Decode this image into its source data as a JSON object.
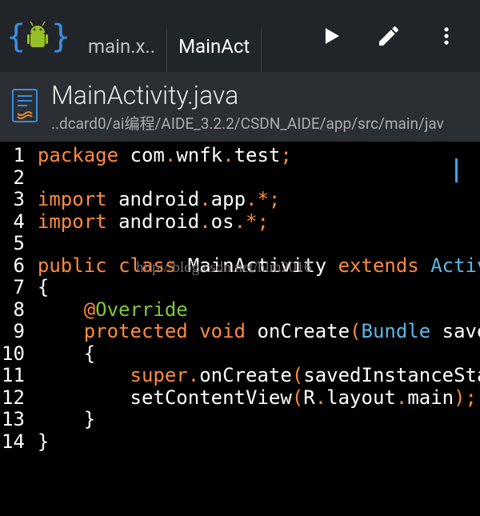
{
  "topbar": {
    "tabs": [
      {
        "label": "main.x.."
      },
      {
        "label": "MainAct"
      }
    ]
  },
  "fileHeader": {
    "title": "MainActivity.java",
    "path": "..dcard0/ai编程/AIDE_3.2.2/CSDN_AIDE/app/src/main/jav"
  },
  "code": {
    "lines": [
      {
        "n": "1",
        "tokens": [
          [
            "kw",
            "package "
          ],
          [
            "id",
            "com"
          ],
          [
            "op",
            "."
          ],
          [
            "id",
            "wnfk"
          ],
          [
            "op",
            "."
          ],
          [
            "id",
            "test"
          ],
          [
            "op",
            ";"
          ]
        ]
      },
      {
        "n": "2",
        "tokens": []
      },
      {
        "n": "3",
        "tokens": [
          [
            "kw",
            "import "
          ],
          [
            "id",
            "android"
          ],
          [
            "op",
            "."
          ],
          [
            "id",
            "app"
          ],
          [
            "op",
            ".*;"
          ]
        ]
      },
      {
        "n": "4",
        "tokens": [
          [
            "kw",
            "import "
          ],
          [
            "id",
            "android"
          ],
          [
            "op",
            "."
          ],
          [
            "id",
            "os"
          ],
          [
            "op",
            ".*;"
          ]
        ]
      },
      {
        "n": "5",
        "tokens": []
      },
      {
        "n": "6",
        "tokens": [
          [
            "kw",
            "public "
          ],
          [
            "kw",
            "class "
          ],
          [
            "id",
            "MainActivity "
          ],
          [
            "kw",
            "extends "
          ],
          [
            "ty",
            "Activity"
          ]
        ]
      },
      {
        "n": "7",
        "tokens": [
          [
            "id",
            "{"
          ]
        ]
      },
      {
        "n": "8",
        "tokens": [
          [
            "id",
            "    "
          ],
          [
            "op",
            "@"
          ],
          [
            "an",
            "Override"
          ]
        ]
      },
      {
        "n": "9",
        "tokens": [
          [
            "id",
            "    "
          ],
          [
            "kw",
            "protected "
          ],
          [
            "kw",
            "void "
          ],
          [
            "id",
            "onCreate"
          ],
          [
            "op",
            "("
          ],
          [
            "ty",
            "Bundle "
          ],
          [
            "id",
            "savedIn"
          ]
        ]
      },
      {
        "n": "10",
        "tokens": [
          [
            "id",
            "    {"
          ]
        ]
      },
      {
        "n": "11",
        "tokens": [
          [
            "id",
            "        "
          ],
          [
            "kw",
            "super"
          ],
          [
            "op",
            "."
          ],
          [
            "id",
            "onCreate"
          ],
          [
            "op",
            "("
          ],
          [
            "id",
            "savedInstanceState"
          ],
          [
            "op",
            ")"
          ]
        ]
      },
      {
        "n": "12",
        "tokens": [
          [
            "id",
            "        setContentView"
          ],
          [
            "op",
            "("
          ],
          [
            "id",
            "R"
          ],
          [
            "op",
            "."
          ],
          [
            "id",
            "layout"
          ],
          [
            "op",
            "."
          ],
          [
            "id",
            "main"
          ],
          [
            "op",
            ");"
          ]
        ]
      },
      {
        "n": "13",
        "tokens": [
          [
            "id",
            "    }"
          ]
        ]
      },
      {
        "n": "14",
        "tokens": [
          [
            "id",
            "}"
          ]
        ]
      }
    ]
  },
  "watermark": "http://blog.csdn.net/hlm2016"
}
